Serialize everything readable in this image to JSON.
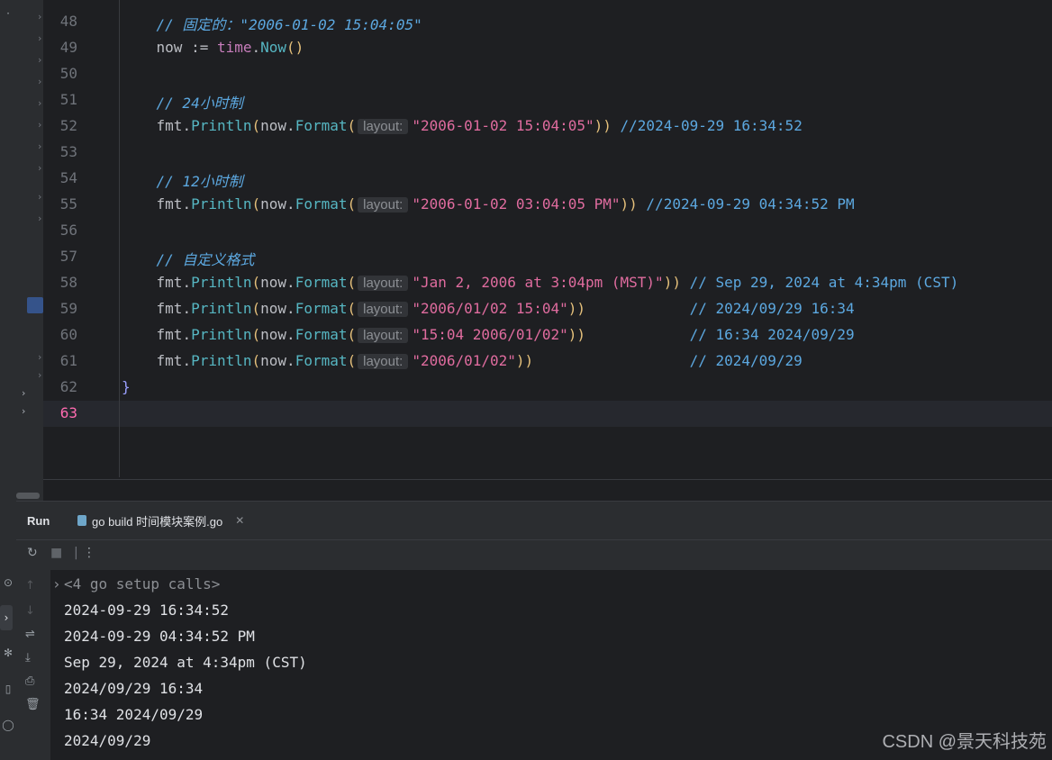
{
  "editor": {
    "lines": [
      {
        "num": "48",
        "text": "// 固定的：\"2006-01-02 15:04:05\""
      },
      {
        "num": "49",
        "text": "now := time.Now()"
      },
      {
        "num": "50",
        "text": ""
      },
      {
        "num": "51",
        "text": "// 24小时制"
      },
      {
        "num": "52",
        "text": "fmt.Println(now.Format(layout: \"2006-01-02 15:04:05\")) //2024-09-29 16:34:52"
      },
      {
        "num": "53",
        "text": ""
      },
      {
        "num": "54",
        "text": "// 12小时制"
      },
      {
        "num": "55",
        "text": "fmt.Println(now.Format(layout: \"2006-01-02 03:04:05 PM\")) //2024-09-29 04:34:52 PM"
      },
      {
        "num": "56",
        "text": ""
      },
      {
        "num": "57",
        "text": "// 自定义格式"
      },
      {
        "num": "58",
        "text": "fmt.Println(now.Format(layout: \"Jan 2, 2006 at 3:04pm (MST)\")) // Sep 29, 2024 at 4:34pm (CST)"
      },
      {
        "num": "59",
        "text": "fmt.Println(now.Format(layout: \"2006/01/02 15:04\"))            // 2024/09/29 16:34"
      },
      {
        "num": "60",
        "text": "fmt.Println(now.Format(layout: \"15:04 2006/01/02\"))            // 16:34 2024/09/29"
      },
      {
        "num": "61",
        "text": "fmt.Println(now.Format(layout: \"2006/01/02\"))                  // 2024/09/29"
      },
      {
        "num": "62",
        "text": "}"
      },
      {
        "num": "63",
        "text": ""
      }
    ],
    "hint_label": "layout:",
    "current_line": "63"
  },
  "run_panel": {
    "title": "Run",
    "tab_label": "go build 时间模块案例.go",
    "setup_calls": "<4 go setup calls>",
    "output": [
      "2024-09-29 16:34:52",
      "2024-09-29 04:34:52 PM",
      "Sep 29, 2024 at 4:34pm (CST)",
      "2024/09/29 16:34",
      "16:34 2024/09/29",
      "2024/09/29"
    ]
  },
  "watermark": "CSDN @景天科技苑",
  "colors": {
    "background": "#1e1f22",
    "comment": "#5ca8e0",
    "string": "#e06c9f",
    "function": "#56b6c2",
    "current_line_number": "#ff6bb0"
  }
}
